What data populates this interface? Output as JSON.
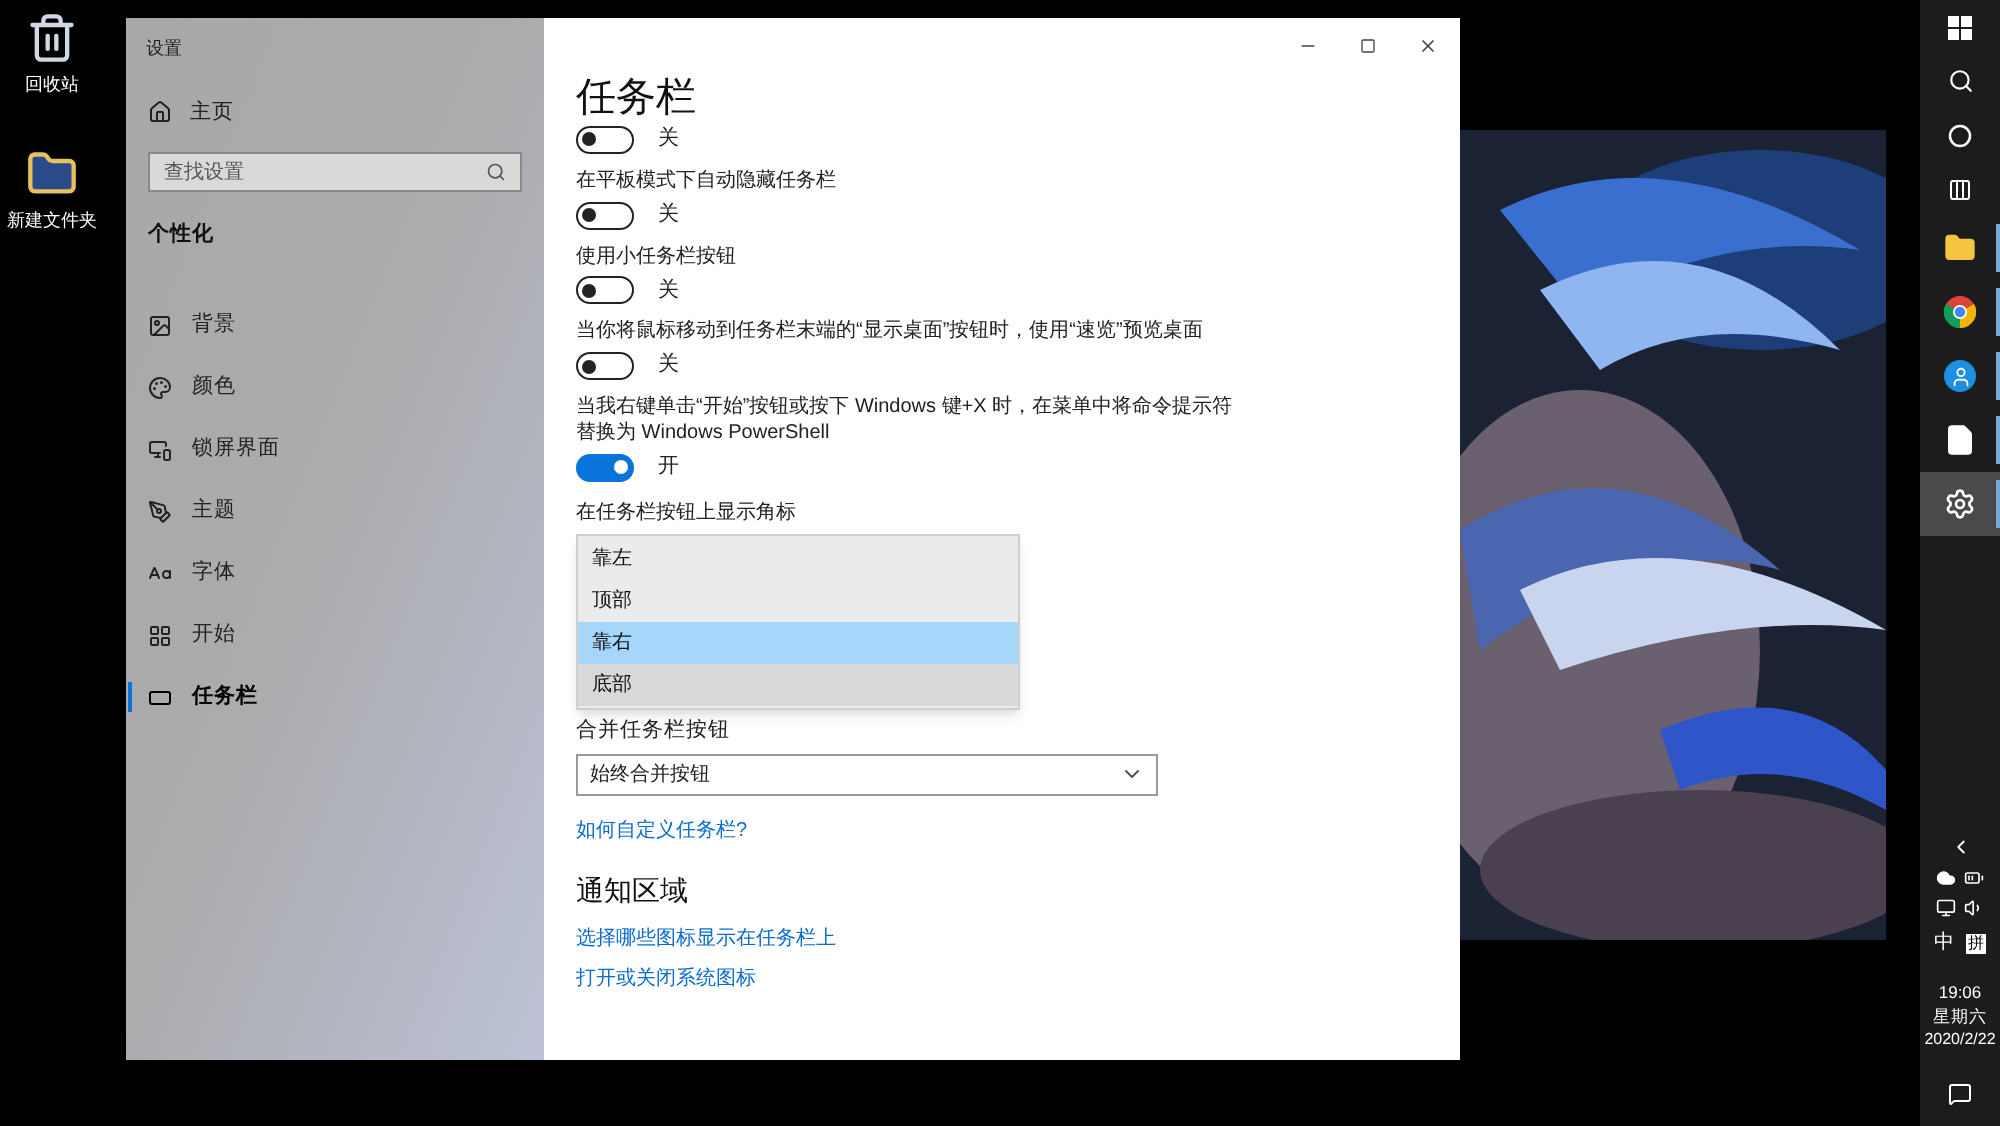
{
  "desktop": {
    "icons": [
      {
        "label": "回收站"
      },
      {
        "label": "新建文件夹"
      }
    ]
  },
  "window": {
    "title": "设置",
    "sidebar": {
      "home": "主页",
      "search": {
        "placeholder": "查找设置"
      },
      "section": "个性化",
      "items": [
        {
          "label": "背景",
          "selected": false
        },
        {
          "label": "颜色",
          "selected": false
        },
        {
          "label": "锁屏界面",
          "selected": false
        },
        {
          "label": "主题",
          "selected": false
        },
        {
          "label": "字体",
          "selected": false
        },
        {
          "label": "开始",
          "selected": false
        },
        {
          "label": "任务栏",
          "selected": true
        }
      ]
    },
    "page_title": "任务栏",
    "toggles": [
      {
        "on": false,
        "state_text": "关"
      },
      {
        "label": "在平板模式下自动隐藏任务栏",
        "on": false,
        "state_text": "关"
      },
      {
        "label": "使用小任务栏按钮",
        "on": false,
        "state_text": "关"
      },
      {
        "label": "当你将鼠标移动到任务栏末端的“显示桌面”按钮时，使用“速览”预览桌面",
        "on": false,
        "state_text": "关"
      },
      {
        "label": "当我右键单击“开始”按钮或按下 Windows 键+X 时，在菜单中将命令提示符替换为 Windows PowerShell",
        "on": true,
        "state_text": "开"
      }
    ],
    "badge_position": {
      "label": "在任务栏按钮上显示角标",
      "options": [
        {
          "label": "靠左",
          "selected": false,
          "hovered": false
        },
        {
          "label": "顶部",
          "selected": false,
          "hovered": false
        },
        {
          "label": "靠右",
          "selected": true,
          "hovered": false
        },
        {
          "label": "底部",
          "selected": false,
          "hovered": true
        }
      ]
    },
    "combine": {
      "label": "合并任务栏按钮",
      "value": "始终合并按钮"
    },
    "help_link": "如何自定义任务栏?",
    "notification_heading": "通知区域",
    "notification_links": [
      "选择哪些图标显示在任务栏上",
      "打开或关闭系统图标"
    ]
  },
  "taskbar": {
    "apps": [
      {
        "selected": false
      },
      {
        "selected": false
      },
      {
        "selected": false
      },
      {
        "selected": false
      },
      {
        "selected": true
      }
    ],
    "ime_mode": "中",
    "ime": "拼",
    "time": "19:06",
    "weekday": "星期六",
    "date": "2020/2/22"
  }
}
